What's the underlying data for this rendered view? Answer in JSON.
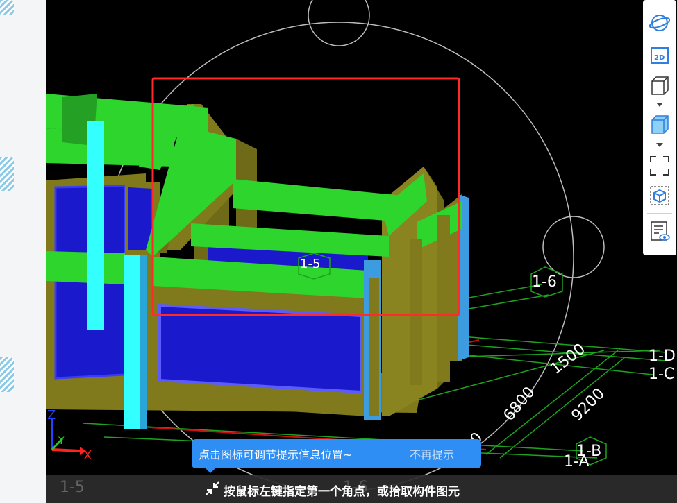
{
  "viewport": {
    "grid_labels": {
      "axis_1_6": "1-6",
      "axis_1_5": "1-5",
      "axis_1_D": "1-D",
      "axis_1_C": "1-C",
      "axis_1_B": "1-B",
      "axis_1_A": "1-A"
    },
    "dimensions": {
      "d1500": "1500",
      "d6800": "6800",
      "d9200": "9200",
      "d0": "0"
    },
    "axes": {
      "x": "X",
      "y": "Y",
      "z": "Z"
    }
  },
  "toolbar": {
    "items": [
      {
        "icon": "orbit-icon"
      },
      {
        "icon": "2d-view-icon",
        "label": "2D"
      },
      {
        "icon": "3d-wireframe-icon"
      },
      {
        "icon": "3d-solid-icon"
      },
      {
        "icon": "fit-view-icon"
      },
      {
        "icon": "isolate-view-icon"
      },
      {
        "icon": "visibility-settings-icon"
      }
    ]
  },
  "tooltip": {
    "text": "点击图标可调节提示信息位置~",
    "dismiss": "不再提示"
  },
  "status_bar": {
    "message": "按鼠标左键指定第一个角点，或拾取构件图元",
    "grid_label": "1-5",
    "grid_label_2": "1-6"
  },
  "colors": {
    "beam": "#2dd52d",
    "wall": "#807a1c",
    "column": "#33ffff",
    "window": "#1a1acc",
    "grid": "#1fa31f",
    "selection": "#ff2a2a",
    "tooltip": "#2e8ef3"
  }
}
